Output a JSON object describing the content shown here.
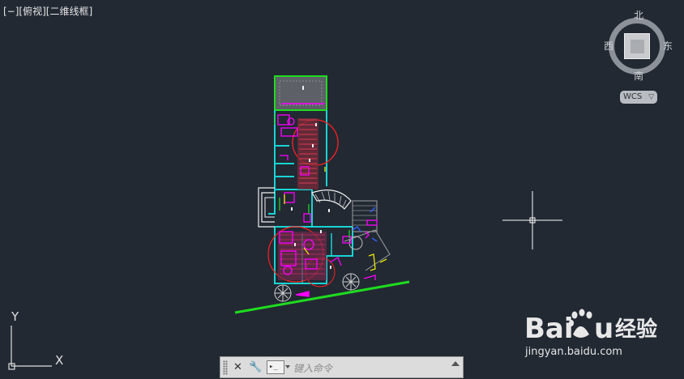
{
  "viewport": {
    "control_label": "[−]",
    "view_label": "[俯视]",
    "style_label": "[二维线框]"
  },
  "viewcube": {
    "north": "北",
    "south": "南",
    "east": "东",
    "west": "西",
    "wcs_label": "WCS",
    "wcs_chevron": "▽"
  },
  "ucs": {
    "y_label": "Y",
    "x_label": "X"
  },
  "command_line": {
    "close_glyph": "✕",
    "customize_glyph": "🔧",
    "prompt_glyph": "▸_",
    "placeholder": "键入命令"
  },
  "watermark": {
    "brand": "Baidu经验",
    "url": "jingyan.baidu.com"
  },
  "colors": {
    "background": "#222933",
    "cyan": "#19d3d3",
    "magenta": "#ff00ff",
    "red": "#ff2020",
    "green": "#1fdc1f",
    "yellow": "#e8e800",
    "white": "#f0f0f0"
  }
}
